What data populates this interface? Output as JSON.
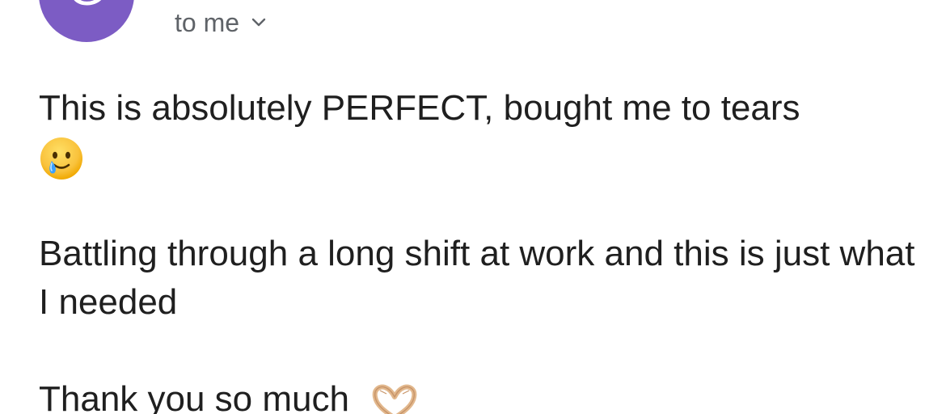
{
  "header": {
    "avatar_letter": "G",
    "recipient_label": "to me"
  },
  "message": {
    "line1": "This is absolutely PERFECT, bought me to tears",
    "para2": "Battling through a long shift at work and this is just what I needed",
    "para3": "Thank you so much"
  },
  "icons": {
    "emoji_1": "smiling-face-with-tear-icon",
    "emoji_2": "heart-hands-icon",
    "chevron": "chevron-down-icon"
  },
  "colors": {
    "avatar_bg": "#7c5cc4",
    "text": "#1f1f1f",
    "meta_text": "#5f6368"
  }
}
